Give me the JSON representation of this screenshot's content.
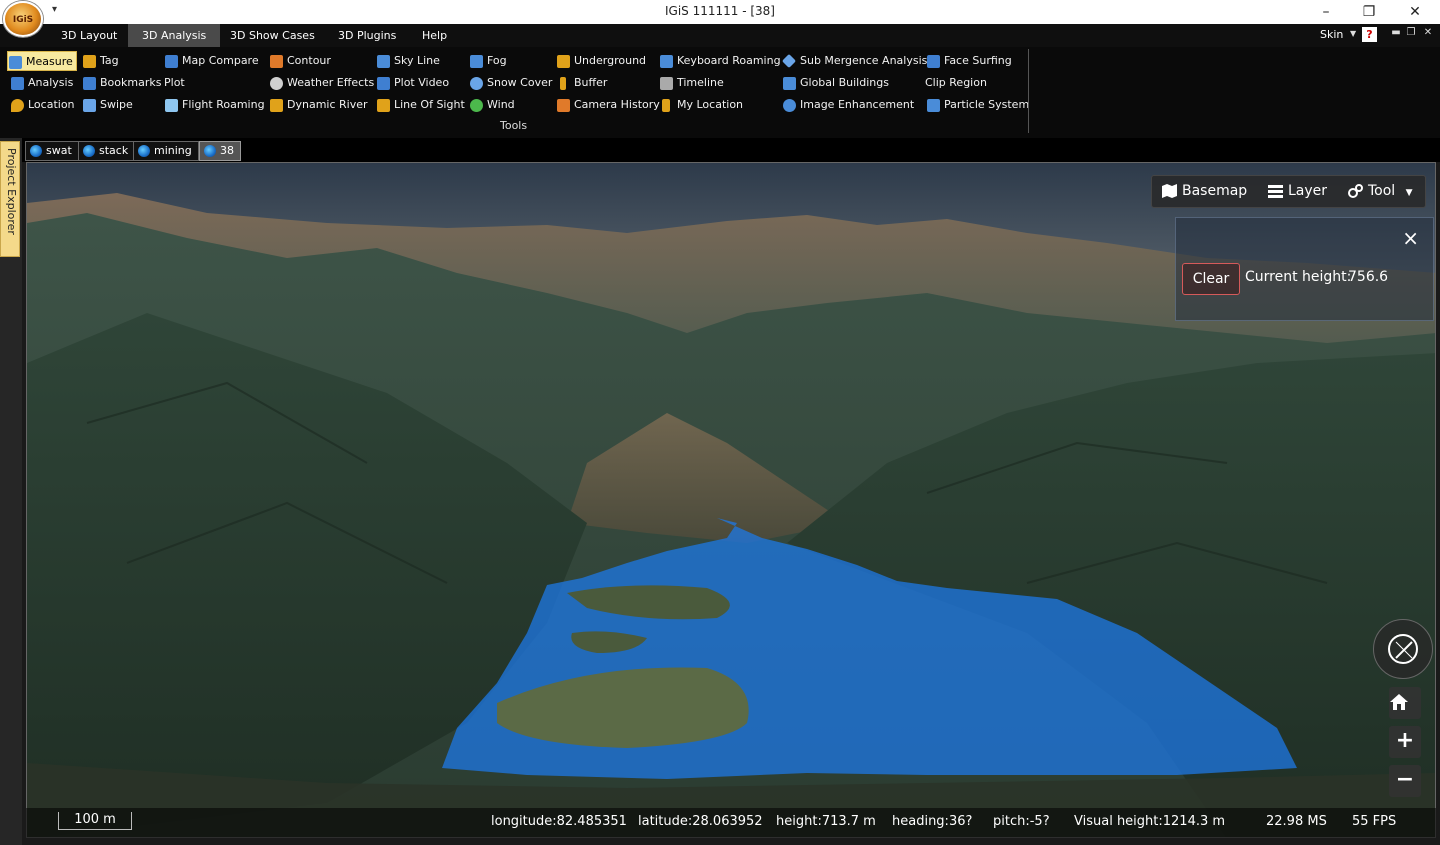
{
  "window": {
    "title": "IGiS 111111 - [38]",
    "logo_text": "IGiS",
    "controls": [
      "–",
      "❐",
      "✕"
    ]
  },
  "menu": {
    "tabs": [
      "3D Layout",
      "3D Analysis",
      "3D Show Cases",
      "3D Plugins",
      "Help"
    ],
    "active": "3D Analysis",
    "skin_label": "Skin",
    "help_glyph": "?"
  },
  "ribbon": {
    "group_label": "Tools",
    "items": [
      {
        "label": "Measure",
        "icon": "measure-icon",
        "color": "#4a8cd8"
      },
      {
        "label": "Analysis",
        "icon": "analysis-icon",
        "color": "#3f7fd1"
      },
      {
        "label": "Location",
        "icon": "location-icon",
        "color": "#e0a21a"
      },
      {
        "label": "Tag",
        "icon": "tag-icon",
        "color": "#e0a21a"
      },
      {
        "label": "Bookmarks",
        "icon": "bookmark-icon",
        "color": "#3f7fd1"
      },
      {
        "label": "Swipe",
        "icon": "swipe-icon",
        "color": "#6aa5e8"
      },
      {
        "label": "Map Compare",
        "icon": "map-compare-icon",
        "color": "#3f7fd1"
      },
      {
        "label": "Plot",
        "icon": "plot-icon",
        "color": ""
      },
      {
        "label": "Flight Roaming",
        "icon": "flight-icon",
        "color": "#8fc7f0"
      },
      {
        "label": "Contour",
        "icon": "contour-icon",
        "color": "#e07a2a"
      },
      {
        "label": "Weather Effects",
        "icon": "weather-icon",
        "color": "#d0d0d0"
      },
      {
        "label": "Dynamic River",
        "icon": "river-icon",
        "color": "#e0a21a"
      },
      {
        "label": "Sky Line",
        "icon": "skyline-icon",
        "color": "#4a8cd8"
      },
      {
        "label": "Plot Video",
        "icon": "video-icon",
        "color": "#3f7fd1"
      },
      {
        "label": "Line Of Sight",
        "icon": "line-of-sight-icon",
        "color": "#e0a21a"
      },
      {
        "label": "Fog",
        "icon": "fog-icon",
        "color": "#4a8cd8"
      },
      {
        "label": "Snow Cover",
        "icon": "snow-icon",
        "color": "#6aa5e8"
      },
      {
        "label": "Wind",
        "icon": "wind-icon",
        "color": "#4cb84c"
      },
      {
        "label": "Underground",
        "icon": "underground-icon",
        "color": "#e0a21a"
      },
      {
        "label": "Buffer",
        "icon": "buffer-icon",
        "color": "#e0a21a"
      },
      {
        "label": "Camera History",
        "icon": "camera-history-icon",
        "color": "#e07a2a"
      },
      {
        "label": "Keyboard Roaming",
        "icon": "keyboard-icon",
        "color": "#4a8cd8"
      },
      {
        "label": "Timeline",
        "icon": "timeline-icon",
        "color": "#aaaaaa"
      },
      {
        "label": "My Location",
        "icon": "person-icon",
        "color": "#e0a21a"
      },
      {
        "label": "Sub Mergence Analysis",
        "icon": "submergence-icon",
        "color": "#6aa5e8"
      },
      {
        "label": "Global Buildings",
        "icon": "buildings-icon",
        "color": "#4a8cd8"
      },
      {
        "label": "Image Enhancement",
        "icon": "image-enhance-icon",
        "color": "#4a8cd8"
      },
      {
        "label": "Face Surfing",
        "icon": "face-surfing-icon",
        "color": "#3f7fd1"
      },
      {
        "label": "Clip Region",
        "icon": "clip-region-icon",
        "color": ""
      },
      {
        "label": "Particle System",
        "icon": "particle-icon",
        "color": "#4a8cd8"
      }
    ]
  },
  "sidebar": {
    "project_explorer_label": "Project Explorer"
  },
  "doc_tabs": [
    {
      "label": "swat",
      "active": false
    },
    {
      "label": "stack",
      "active": false
    },
    {
      "label": "mining",
      "active": false
    },
    {
      "label": "38",
      "active": true
    }
  ],
  "map_toolbar": {
    "basemap": "Basemap",
    "layer": "Layer",
    "tool": "Tool"
  },
  "measure_panel": {
    "close": "×",
    "clear": "Clear",
    "height_label": "Current height:",
    "height_value": "756.6"
  },
  "nav": {
    "plus": "+",
    "minus": "−"
  },
  "status": {
    "scale": "100 m",
    "longitude": "longitude:82.485351",
    "latitude": "latitude:28.063952",
    "height": "height:713.7 m",
    "heading": "heading:36?",
    "pitch": "pitch:-5?",
    "visual_height": "Visual height:1214.3 m",
    "ms": "22.98 MS",
    "fps": "55 FPS"
  },
  "colors": {
    "flood_fill": "#1e78e6",
    "terrain_dark": "#2a3d34",
    "sky": "#3a4a5e",
    "ribbon_selected": "#f7e9a0"
  }
}
